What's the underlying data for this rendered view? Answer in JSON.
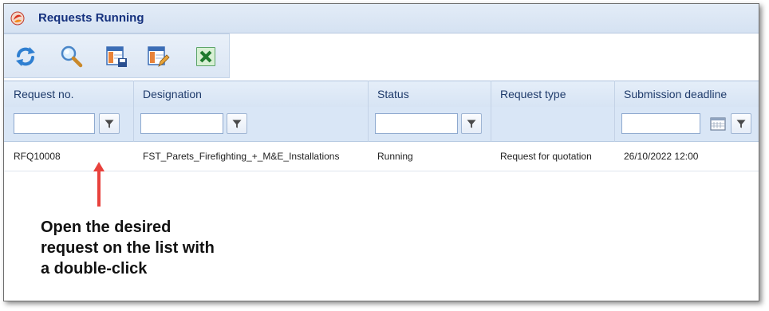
{
  "window": {
    "title": "Requests Running"
  },
  "toolbar": {
    "buttons": [
      {
        "icon": "refresh-icon"
      },
      {
        "icon": "search-icon"
      },
      {
        "icon": "save-layout-icon"
      },
      {
        "icon": "edit-layout-icon"
      },
      {
        "icon": "excel-export-icon"
      }
    ]
  },
  "grid": {
    "columns": [
      "Request no.",
      "Designation",
      "Status",
      "Request type",
      "Submission deadline"
    ],
    "filters": {
      "request_no": "",
      "designation": "",
      "status": "",
      "deadline": ""
    },
    "rows": [
      {
        "request_no": "RFQ10008",
        "designation": "FST_Parets_Firefighting_+_M&E_Installations",
        "status": "Running",
        "request_type": "Request for quotation",
        "deadline": "26/10/2022 12:00"
      }
    ]
  },
  "annotation": {
    "lines": [
      "Open the desired",
      "request on the list with",
      "a double-click"
    ],
    "arrow_color": "#e8413c"
  },
  "colors": {
    "title_text": "#15317e",
    "header_bg": "#d7e4f4",
    "filter_bg": "#d9e6f6"
  }
}
